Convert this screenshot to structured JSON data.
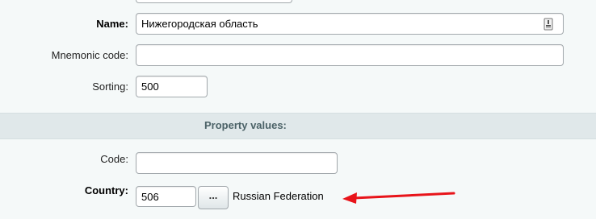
{
  "fields": {
    "name": {
      "label": "Name:",
      "value": "Нижегородская область"
    },
    "mnemonic": {
      "label": "Mnemonic code:",
      "value": ""
    },
    "sorting": {
      "label": "Sorting:",
      "value": "500"
    },
    "code": {
      "label": "Code:",
      "value": ""
    },
    "country": {
      "label": "Country:",
      "value": "506",
      "browse_label": "...",
      "display_name": "Russian Federation"
    }
  },
  "section": {
    "title": "Property values:"
  },
  "icons": {
    "translit": "translit-icon",
    "arrow": "red-arrow-annotation"
  },
  "colors": {
    "arrow": "#e8141a",
    "section_bg": "#e0e8ea",
    "section_text": "#4b6267"
  }
}
